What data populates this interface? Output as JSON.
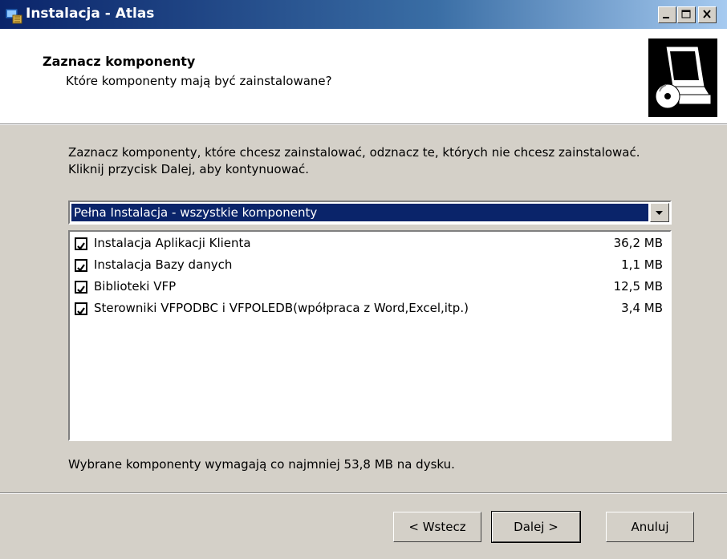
{
  "window": {
    "title": "Instalacja - Atlas",
    "icon": "installer-app-icon",
    "controls": [
      "minimize-icon",
      "maximize-icon",
      "close-icon"
    ]
  },
  "header": {
    "title": "Zaznacz komponenty",
    "subtitle": "Które komponenty mają być zainstalowane?",
    "image_icon": "computer-cd-icon"
  },
  "description": "Zaznacz komponenty, które chcesz zainstalować, odznacz te, których nie chcesz zainstalować. Kliknij przycisk Dalej, aby kontynuować.",
  "install_type": {
    "selected": "Pełna Instalacja - wszystkie komponenty",
    "dropdown_icon": "chevron-down-icon"
  },
  "components": [
    {
      "label": "Instalacja Aplikacji Klienta",
      "size": "36,2 MB",
      "checked": true
    },
    {
      "label": "Instalacja Bazy danych",
      "size": "1,1 MB",
      "checked": true
    },
    {
      "label": "Biblioteki VFP",
      "size": "12,5 MB",
      "checked": true
    },
    {
      "label": "Sterowniki VFPODBC i VFPOLEDB(wpółpraca z Word,Excel,itp.)",
      "size": "3,4 MB",
      "checked": true
    }
  ],
  "requirement": "Wybrane komponenty wymagają co najmniej 53,8 MB na dysku.",
  "buttons": {
    "back": "< Wstecz",
    "next": "Dalej >",
    "cancel": "Anuluj"
  },
  "colors": {
    "title_bar_start": "#0a246a",
    "title_bar_end": "#a6caf0",
    "selection": "#0a246a",
    "dialog_bg": "#d4d0c8"
  }
}
